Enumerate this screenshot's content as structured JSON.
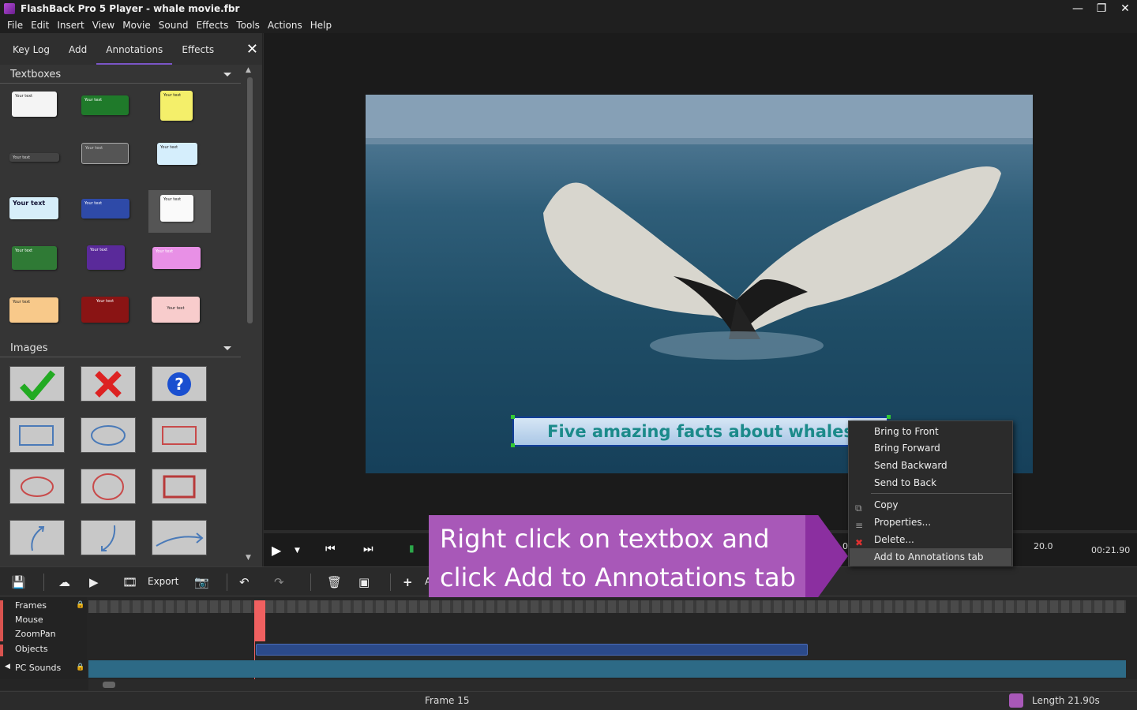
{
  "window": {
    "title": "FlashBack Pro 5 Player - whale movie.fbr"
  },
  "menu": [
    "File",
    "Edit",
    "Insert",
    "View",
    "Movie",
    "Sound",
    "Effects",
    "Tools",
    "Actions",
    "Help"
  ],
  "panel": {
    "tabs": [
      "Key Log",
      "Add",
      "Annotations",
      "Effects"
    ],
    "active_tab": "Annotations",
    "sections": {
      "textboxes": "Textboxes",
      "images": "Images"
    },
    "textbox_samples": [
      "Your text",
      "Your text",
      "Your text",
      "Your text",
      "Your text",
      "Your text",
      "Your text",
      "Your text",
      "Your text",
      "Your text",
      "Your text",
      "Your text",
      "Your text",
      "Your text",
      "Your text"
    ]
  },
  "preview": {
    "textbox_text": "Five amazing facts about whales"
  },
  "playbar": {
    "ruler_label": "20.0",
    "time": "00:21.90",
    "ruler_left": "0"
  },
  "toolbar": {
    "export_label": "Export",
    "partial_label": "A"
  },
  "timeline": {
    "tracks": [
      "Frames",
      "Mouse",
      "ZoomPan",
      "Objects",
      "PC Sounds"
    ]
  },
  "status": {
    "frame": "Frame 15",
    "length": "Length 21.90s"
  },
  "callout": {
    "line1": "Right click on textbox and",
    "line2": "click Add to Annotations tab"
  },
  "context_menu": {
    "items": [
      "Bring to Front",
      "Bring Forward",
      "Send Backward",
      "Send to Back",
      "Copy",
      "Properties...",
      "Delete...",
      "Add to Annotations tab"
    ],
    "highlighted": "Add to Annotations tab"
  },
  "colors": {
    "accent": "#7a55c7",
    "callout": "#a858b8",
    "timeline_cursor": "#f06060"
  }
}
